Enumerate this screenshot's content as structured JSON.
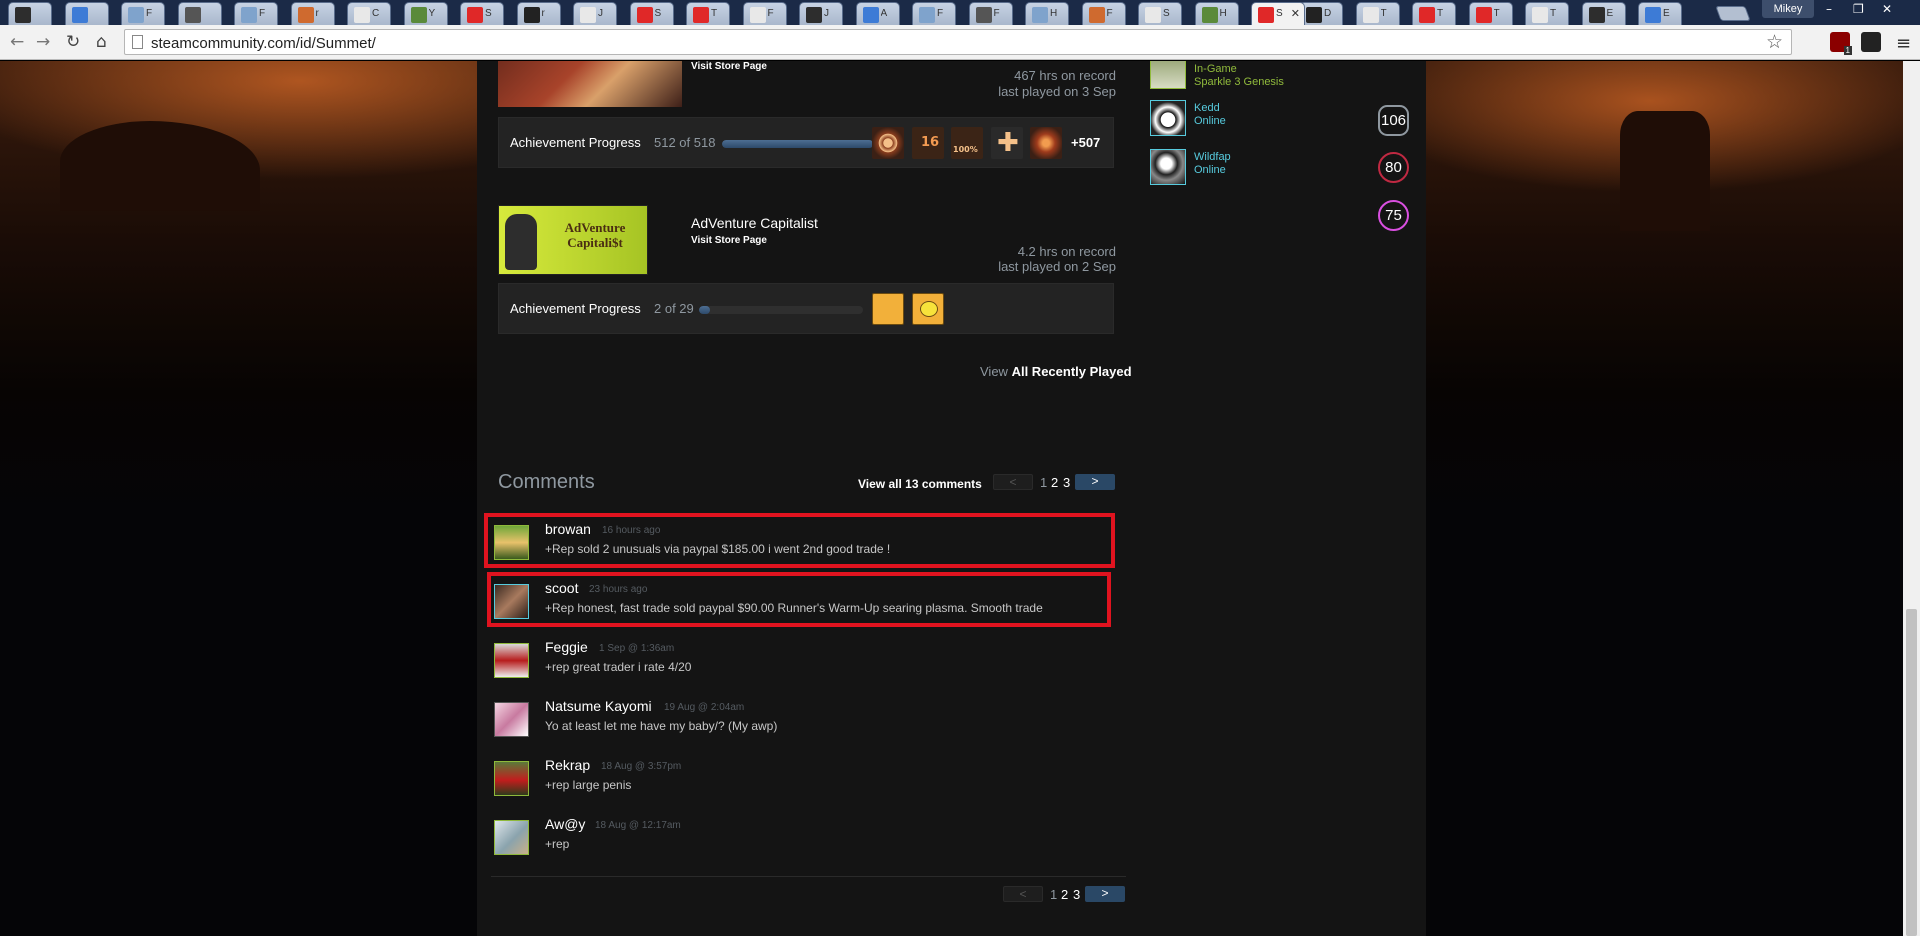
{
  "browser": {
    "active_tab_title": "S",
    "tabs": [
      "",
      "",
      "F",
      "",
      "F",
      "r",
      "C",
      "Y",
      "S",
      "r",
      "J",
      "S",
      "T",
      "F",
      "J",
      "A",
      "F",
      "F",
      "H",
      "F",
      "S",
      "H",
      "L",
      "D",
      "T",
      "T",
      "T",
      "T",
      "E",
      "E"
    ],
    "profile_name": "Mikey",
    "url": "steamcommunity.com/id/Summet/",
    "ext_badge": "1"
  },
  "games": [
    {
      "name": "",
      "store_link": "Visit Store Page",
      "hours": "467 hrs on record",
      "last_played": "last played on 3 Sep",
      "ach_label": "Achievement Progress",
      "ach_count": "512 of 518",
      "ach_fraction": 0.988,
      "ach_more": "+507"
    },
    {
      "name": "AdVenture Capitalist",
      "image_text": "AdVenture Capitali$t",
      "store_link": "Visit Store Page",
      "hours": "4.2 hrs on record",
      "last_played": "last played on 2 Sep",
      "ach_label": "Achievement Progress",
      "ach_count": "2 of 29",
      "ach_fraction": 0.069
    }
  ],
  "view_all": {
    "prefix": "View",
    "label": "All Recently Played"
  },
  "comments_section": {
    "title": "Comments",
    "view_all_label": "View all 13 comments",
    "pager": {
      "prev": "<",
      "next": ">",
      "pages": [
        "1",
        "2",
        "3"
      ]
    },
    "items": [
      {
        "author": "browan",
        "time": "16 hours ago",
        "text": "+Rep sold 2 unusuals via paypal $185.00 i went 2nd good trade !"
      },
      {
        "author": "scoot",
        "time": "23 hours ago",
        "text": "+Rep honest, fast trade sold paypal $90.00 Runner's Warm-Up searing plasma. Smooth trade"
      },
      {
        "author": "Feggie",
        "time": "1 Sep @ 1:36am",
        "text": "+rep great trader i rate 4/20"
      },
      {
        "author": "Natsume Kayomi",
        "time": "19 Aug @ 2:04am",
        "text": "Yo at least let me have my baby/? (My awp)"
      },
      {
        "author": "Rekrap",
        "time": "18 Aug @ 3:57pm",
        "text": "+rep large penis"
      },
      {
        "author": "Aw@y",
        "time": "18 Aug @ 12:17am",
        "text": "+rep"
      }
    ]
  },
  "friends": [
    {
      "name": "",
      "status": "In-Game",
      "game": "Sparkle 3 Genesis",
      "level": "106",
      "level_color": "#8f98a0"
    },
    {
      "name": "Kedd",
      "status": "Online",
      "level": "80",
      "level_color": "#c02942"
    },
    {
      "name": "Wildfap",
      "status": "Online",
      "level": "75",
      "level_color": "#d94fe0"
    }
  ],
  "colors": {
    "accent_highlight": "#e0131f",
    "online": "#57cbde",
    "ingame": "#90ba3c",
    "pager_active": "#2a4866"
  }
}
